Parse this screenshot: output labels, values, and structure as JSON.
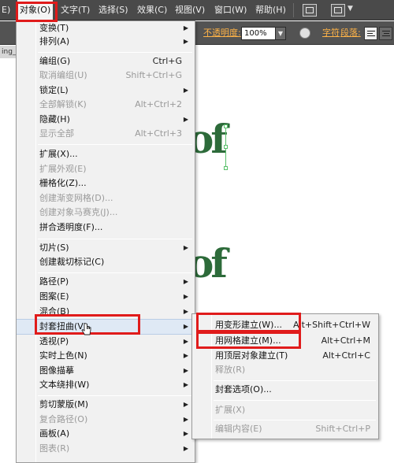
{
  "menubar": {
    "items": [
      {
        "label": "E)"
      },
      {
        "label": "对象(O)"
      },
      {
        "label": "文字(T)"
      },
      {
        "label": "选择(S)"
      },
      {
        "label": "效果(C)"
      },
      {
        "label": "视图(V)"
      },
      {
        "label": "窗口(W)"
      },
      {
        "label": "帮助(H)"
      }
    ],
    "active_index": 1
  },
  "control_bar": {
    "opacity_label": "不透明度:",
    "opacity_value": "100%",
    "char_label": "字符",
    "para_label": "段落:"
  },
  "canvas": {
    "tab_label": "ing_",
    "art_text_1": "of",
    "art_text_2": "of"
  },
  "object_menu": {
    "items": [
      {
        "label": "变换(T)",
        "shortcut": "",
        "submenu": true,
        "disabled": false
      },
      {
        "label": "排列(A)",
        "shortcut": "",
        "submenu": true,
        "disabled": false
      },
      {
        "label": "编组(G)",
        "shortcut": "Ctrl+G",
        "submenu": false,
        "disabled": false
      },
      {
        "label": "取消编组(U)",
        "shortcut": "Shift+Ctrl+G",
        "submenu": false,
        "disabled": true
      },
      {
        "label": "锁定(L)",
        "shortcut": "",
        "submenu": true,
        "disabled": false
      },
      {
        "label": "全部解锁(K)",
        "shortcut": "Alt+Ctrl+2",
        "submenu": false,
        "disabled": true
      },
      {
        "label": "隐藏(H)",
        "shortcut": "",
        "submenu": true,
        "disabled": false
      },
      {
        "label": "显示全部",
        "shortcut": "Alt+Ctrl+3",
        "submenu": false,
        "disabled": true
      },
      {
        "label": "扩展(X)...",
        "shortcut": "",
        "submenu": false,
        "disabled": false
      },
      {
        "label": "扩展外观(E)",
        "shortcut": "",
        "submenu": false,
        "disabled": true
      },
      {
        "label": "栅格化(Z)...",
        "shortcut": "",
        "submenu": false,
        "disabled": false
      },
      {
        "label": "创建渐变网格(D)...",
        "shortcut": "",
        "submenu": false,
        "disabled": true
      },
      {
        "label": "创建对象马赛克(J)...",
        "shortcut": "",
        "submenu": false,
        "disabled": true
      },
      {
        "label": "拼合透明度(F)...",
        "shortcut": "",
        "submenu": false,
        "disabled": false
      },
      {
        "label": "切片(S)",
        "shortcut": "",
        "submenu": true,
        "disabled": false
      },
      {
        "label": "创建裁切标记(C)",
        "shortcut": "",
        "submenu": false,
        "disabled": false
      },
      {
        "label": "路径(P)",
        "shortcut": "",
        "submenu": true,
        "disabled": false
      },
      {
        "label": "图案(E)",
        "shortcut": "",
        "submenu": true,
        "disabled": false
      },
      {
        "label": "混合(B)",
        "shortcut": "",
        "submenu": true,
        "disabled": false
      },
      {
        "label": "封套扭曲(V)",
        "shortcut": "",
        "submenu": true,
        "disabled": false
      },
      {
        "label": "透视(P)",
        "shortcut": "",
        "submenu": true,
        "disabled": false
      },
      {
        "label": "实时上色(N)",
        "shortcut": "",
        "submenu": true,
        "disabled": false
      },
      {
        "label": "图像描摹",
        "shortcut": "",
        "submenu": true,
        "disabled": false
      },
      {
        "label": "文本绕排(W)",
        "shortcut": "",
        "submenu": true,
        "disabled": false
      },
      {
        "label": "剪切蒙版(M)",
        "shortcut": "",
        "submenu": true,
        "disabled": false
      },
      {
        "label": "复合路径(O)",
        "shortcut": "",
        "submenu": true,
        "disabled": true
      },
      {
        "label": "画板(A)",
        "shortcut": "",
        "submenu": true,
        "disabled": false
      },
      {
        "label": "图表(R)",
        "shortcut": "",
        "submenu": true,
        "disabled": true
      }
    ]
  },
  "envelope_submenu": {
    "items": [
      {
        "label": "用变形建立(W)...",
        "shortcut": "Alt+Shift+Ctrl+W",
        "disabled": false
      },
      {
        "label": "用网格建立(M)...",
        "shortcut": "Alt+Ctrl+M",
        "disabled": false
      },
      {
        "label": "用顶层对象建立(T)",
        "shortcut": "Alt+Ctrl+C",
        "disabled": false
      },
      {
        "label": "释放(R)",
        "shortcut": "",
        "disabled": true
      },
      {
        "label": "封套选项(O)...",
        "shortcut": "",
        "disabled": false
      },
      {
        "label": "扩展(X)",
        "shortcut": "",
        "disabled": true
      },
      {
        "label": "编辑内容(E)",
        "shortcut": "Shift+Ctrl+P",
        "disabled": true
      }
    ]
  },
  "colors": {
    "annotation_red": "#e01b1b",
    "art_green": "#2d6b3a",
    "menubar_bg": "#4a4a4a",
    "highlight": "#dfe9f5"
  }
}
